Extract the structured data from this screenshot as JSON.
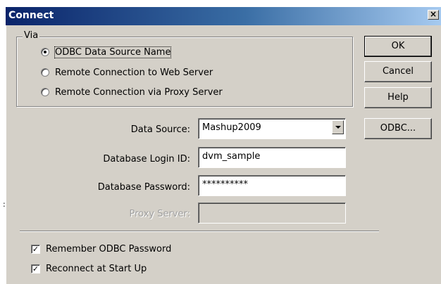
{
  "window": {
    "title": "Connect",
    "close_glyph": "×"
  },
  "via": {
    "label": "Via",
    "options": [
      {
        "label": "ODBC Data Source Name",
        "checked": true
      },
      {
        "label": "Remote Connection to Web Server",
        "checked": false
      },
      {
        "label": "Remote Connection via Proxy Server",
        "checked": false
      }
    ]
  },
  "buttons": {
    "ok": "OK",
    "cancel": "Cancel",
    "help": "Help",
    "odbc": "ODBC..."
  },
  "fields": {
    "data_source": {
      "label": "Data Source:",
      "value": "Mashup2009"
    },
    "login_id": {
      "label": "Database Login ID:",
      "value": "dvm_sample"
    },
    "password": {
      "label": "Database Password:",
      "value": "**********"
    },
    "proxy": {
      "label": "Proxy Server:",
      "value": ""
    }
  },
  "options": {
    "remember_password": {
      "label": "Remember ODBC Password",
      "checked": true
    },
    "reconnect": {
      "label": "Reconnect at Start Up",
      "checked": true
    }
  },
  "check_glyph": "✓",
  "edge_mark": ":",
  "colors": {
    "dialog_face": "#d4d0c8",
    "title_start": "#0a246a",
    "title_end": "#a6caf0"
  }
}
